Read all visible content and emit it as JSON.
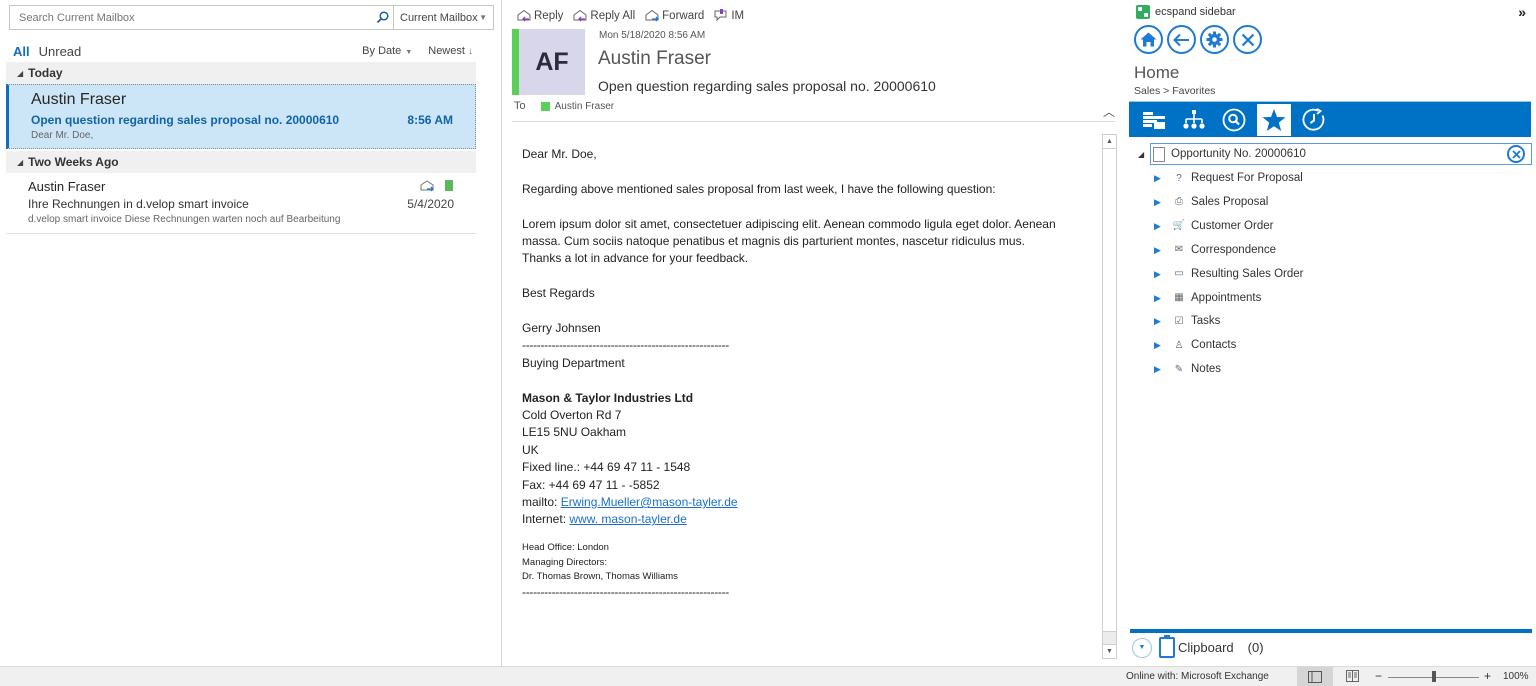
{
  "search": {
    "placeholder": "Search Current Mailbox",
    "scope": "Current Mailbox"
  },
  "filters": {
    "all": "All",
    "unread": "Unread",
    "sort_by": "By Date",
    "order": "Newest"
  },
  "groups": [
    {
      "label": "Today",
      "items": [
        {
          "from": "Austin Fraser",
          "subject": "Open question regarding sales proposal no. 20000610",
          "preview": "Dear Mr. Doe,",
          "time": "8:56 AM",
          "selected": true
        }
      ]
    },
    {
      "label": "Two Weeks Ago",
      "items": [
        {
          "from": "Austin Fraser",
          "subject": "Ihre Rechnungen in d.velop smart invoice",
          "preview": "d.velop smart invoice  Diese Rechnungen warten noch auf Bearbeitung",
          "time": "5/4/2020",
          "category_color": "#5cb85c"
        }
      ]
    }
  ],
  "reading": {
    "actions": {
      "reply": "Reply",
      "reply_all": "Reply All",
      "forward": "Forward",
      "im": "IM"
    },
    "avatar_initials": "AF",
    "date": "Mon 5/18/2020 8:56 AM",
    "from": "Austin Fraser",
    "subject": "Open question regarding sales proposal no. 20000610",
    "to_label": "To",
    "to_name": "Austin Fraser",
    "body": {
      "greeting": "Dear Mr. Doe,",
      "line1": "Regarding above mentioned sales proposal from last week, I have the following question:",
      "para1": "Lorem ipsum dolor sit amet, consectetuer adipiscing elit. Aenean commodo ligula eget dolor. Aenean",
      "para2": "massa. Cum sociis natoque penatibus et magnis dis parturient montes, nascetur ridiculus mus.",
      "para3": "Thanks a lot in advance for your feedback.",
      "closing": "Best Regards",
      "signature_name": "Gerry Johnsen",
      "divider": "--------------------------------------------------------",
      "department": "Buying Department",
      "company": "Mason & Taylor Industries Ltd",
      "street": "Cold Overton Rd 7",
      "city": "LE15 5NU Oakham",
      "country": "UK",
      "phone": "Fixed line.: +44 69 47 11 - 1548",
      "fax": "Fax: +44 69 47 11 - -5852",
      "mail_label": "mailto: ",
      "mail_link": "Erwing.Mueller@mason-tayler.de",
      "web_label": "Internet: ",
      "web_link": "www. mason-tayler.de",
      "head_office": "Head Office: London",
      "directors_label": "Managing Directors:",
      "directors": "Dr. Thomas Brown, Thomas Williams"
    }
  },
  "sidebar": {
    "title": "ecspand sidebar",
    "home": "Home",
    "breadcrumb": "Sales > Favorites",
    "root": "Opportunity No. 20000610",
    "items": [
      {
        "label": "Request For Proposal",
        "icon": "question-icon",
        "glyph": "?"
      },
      {
        "label": "Sales Proposal",
        "icon": "document-icon",
        "glyph": "⎙"
      },
      {
        "label": "Customer Order",
        "icon": "cart-icon",
        "glyph": "🛒"
      },
      {
        "label": "Correspondence",
        "icon": "envelope-icon",
        "glyph": "✉"
      },
      {
        "label": "Resulting Sales Order",
        "icon": "folder-icon",
        "glyph": "▭"
      },
      {
        "label": "Appointments",
        "icon": "calendar-icon",
        "glyph": "▦"
      },
      {
        "label": "Tasks",
        "icon": "checkbox-icon",
        "glyph": "☑"
      },
      {
        "label": "Contacts",
        "icon": "person-icon",
        "glyph": "♙"
      },
      {
        "label": "Notes",
        "icon": "note-icon",
        "glyph": "✎"
      }
    ],
    "clipboard_label": "Clipboard",
    "clipboard_count": "(0)"
  },
  "status": {
    "connection": "Online with: Microsoft Exchange",
    "zoom_pct": "100%",
    "zoom_level": 1.0
  },
  "colors": {
    "accent": "#0072c6",
    "link": "#1a6fc9",
    "selected_bg": "#cde6f7",
    "category_green": "#5ccf58"
  }
}
